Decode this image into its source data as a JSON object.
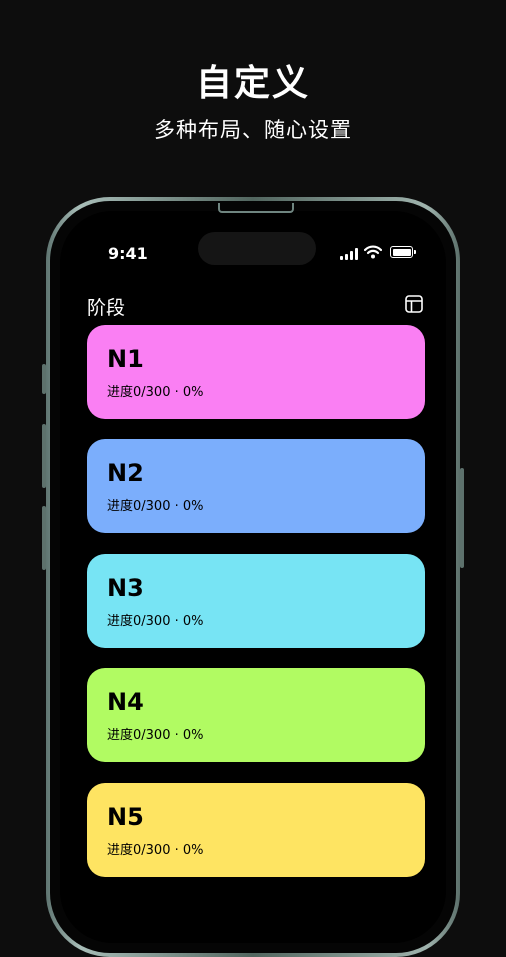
{
  "hero": {
    "title": "自定义",
    "subtitle": "多种布局、随心设置"
  },
  "status_bar": {
    "time": "9:41",
    "icons": [
      "signal-icon",
      "wifi-icon",
      "battery-icon"
    ]
  },
  "header": {
    "title": "阶段",
    "layout_icon": "layout-icon"
  },
  "stages": [
    {
      "name": "N1",
      "progress": "进度0/300 · 0%",
      "color": "#fa7ff3"
    },
    {
      "name": "N2",
      "progress": "进度0/300 · 0%",
      "color": "#7baefc"
    },
    {
      "name": "N3",
      "progress": "进度0/300 · 0%",
      "color": "#77e4f4"
    },
    {
      "name": "N4",
      "progress": "进度0/300 · 0%",
      "color": "#b1fb62"
    },
    {
      "name": "N5",
      "progress": "进度0/300 · 0%",
      "color": "#fee462"
    }
  ],
  "colors": {
    "background": "#0d0d0d",
    "screen": "#000000",
    "frame": "#7d948e"
  }
}
